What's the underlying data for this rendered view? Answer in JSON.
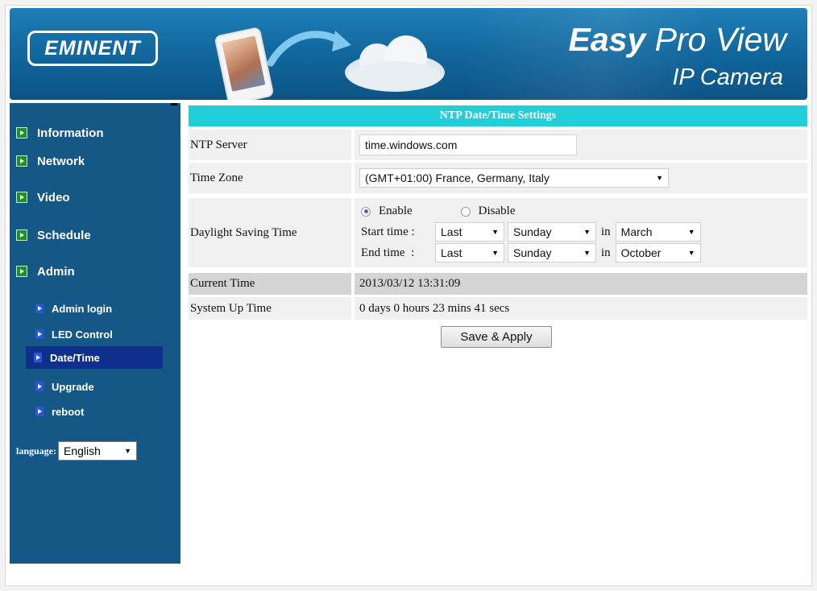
{
  "header": {
    "logo_text": "EMINENT",
    "brand_title_bold": "Easy",
    "brand_title_rest": " Pro View",
    "brand_subtitle": "IP Camera"
  },
  "sidebar": {
    "items": [
      {
        "label": "Information"
      },
      {
        "label": "Network"
      },
      {
        "label": "Video"
      },
      {
        "label": "Schedule"
      },
      {
        "label": "Admin"
      }
    ],
    "admin_sub_items": [
      {
        "label": "Admin login"
      },
      {
        "label": "LED Control"
      },
      {
        "label": "Date/Time",
        "active": true
      },
      {
        "label": "Upgrade"
      },
      {
        "label": "reboot"
      }
    ],
    "language_label": "language:",
    "language_value": "English"
  },
  "settings": {
    "title": "NTP Date/Time Settings",
    "ntp_server_label": "NTP Server",
    "ntp_server_value": "time.windows.com",
    "time_zone_label": "Time Zone",
    "time_zone_value": "(GMT+01:00) France, Germany, Italy",
    "dst_label": "Daylight Saving Time",
    "dst_enable_label": "Enable",
    "dst_disable_label": "Disable",
    "dst_enabled": true,
    "start_time_label": "Start time :",
    "start_week": "Last",
    "start_day": "Sunday",
    "start_in": "in",
    "start_month": "March",
    "end_time_label": "End time  :",
    "end_week": "Last",
    "end_day": "Sunday",
    "end_in": "in",
    "end_month": "October",
    "current_time_label": "Current Time",
    "current_time_value": "2013/03/12 13:31:09",
    "uptime_label": "System Up Time",
    "uptime_value": "0 days 0 hours 23 mins 41 secs",
    "save_button": "Save & Apply"
  },
  "colors": {
    "banner": "#12699f",
    "sidebar": "#155787",
    "title_bar": "#22cfd9",
    "active_item": "#0f2f8c"
  }
}
